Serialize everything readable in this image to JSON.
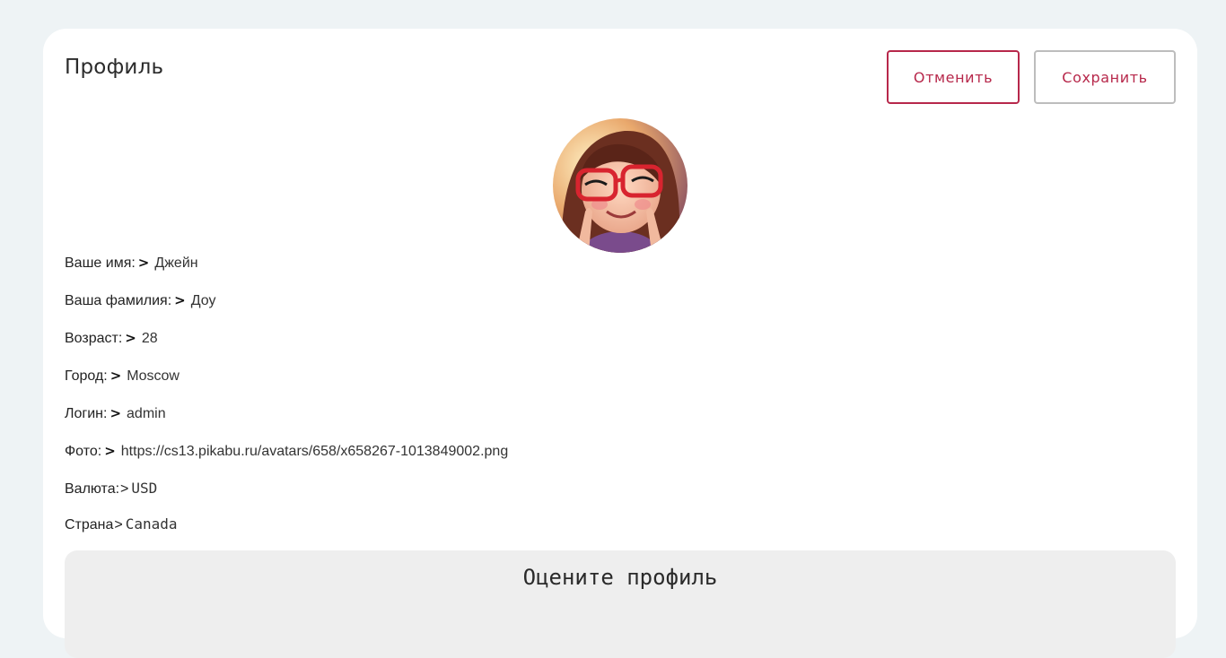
{
  "header": {
    "title": "Профиль",
    "cancel_label": "Отменить",
    "save_label": "Сохранить"
  },
  "colors": {
    "accent": "#b7284b",
    "page_background": "#eef3f5",
    "card_background": "#ffffff",
    "rating_background": "#eeeeee"
  },
  "fields": {
    "first_name": {
      "label": "Ваше имя:",
      "separator": ">",
      "value": "Джейн"
    },
    "last_name": {
      "label": "Ваша фамилия:",
      "separator": ">",
      "value": "Доу"
    },
    "age": {
      "label": "Возраст:",
      "separator": ">",
      "value": "28"
    },
    "city": {
      "label": "Город:",
      "separator": ">",
      "value": "Moscow"
    },
    "login": {
      "label": "Логин:",
      "separator": ">",
      "value": "admin"
    },
    "photo": {
      "label": "Фото:",
      "separator": ">",
      "value": "https://cs13.pikabu.ru/avatars/658/x658267-1013849002.png"
    },
    "currency": {
      "label": "Валюта:",
      "separator": ">",
      "value": "USD"
    },
    "country": {
      "label": "Страна",
      "separator": ">",
      "value": "Canada"
    }
  },
  "rating": {
    "title": "Оцените профиль"
  },
  "icons": {
    "avatar": "avatar-cartoon-girl-glasses"
  }
}
